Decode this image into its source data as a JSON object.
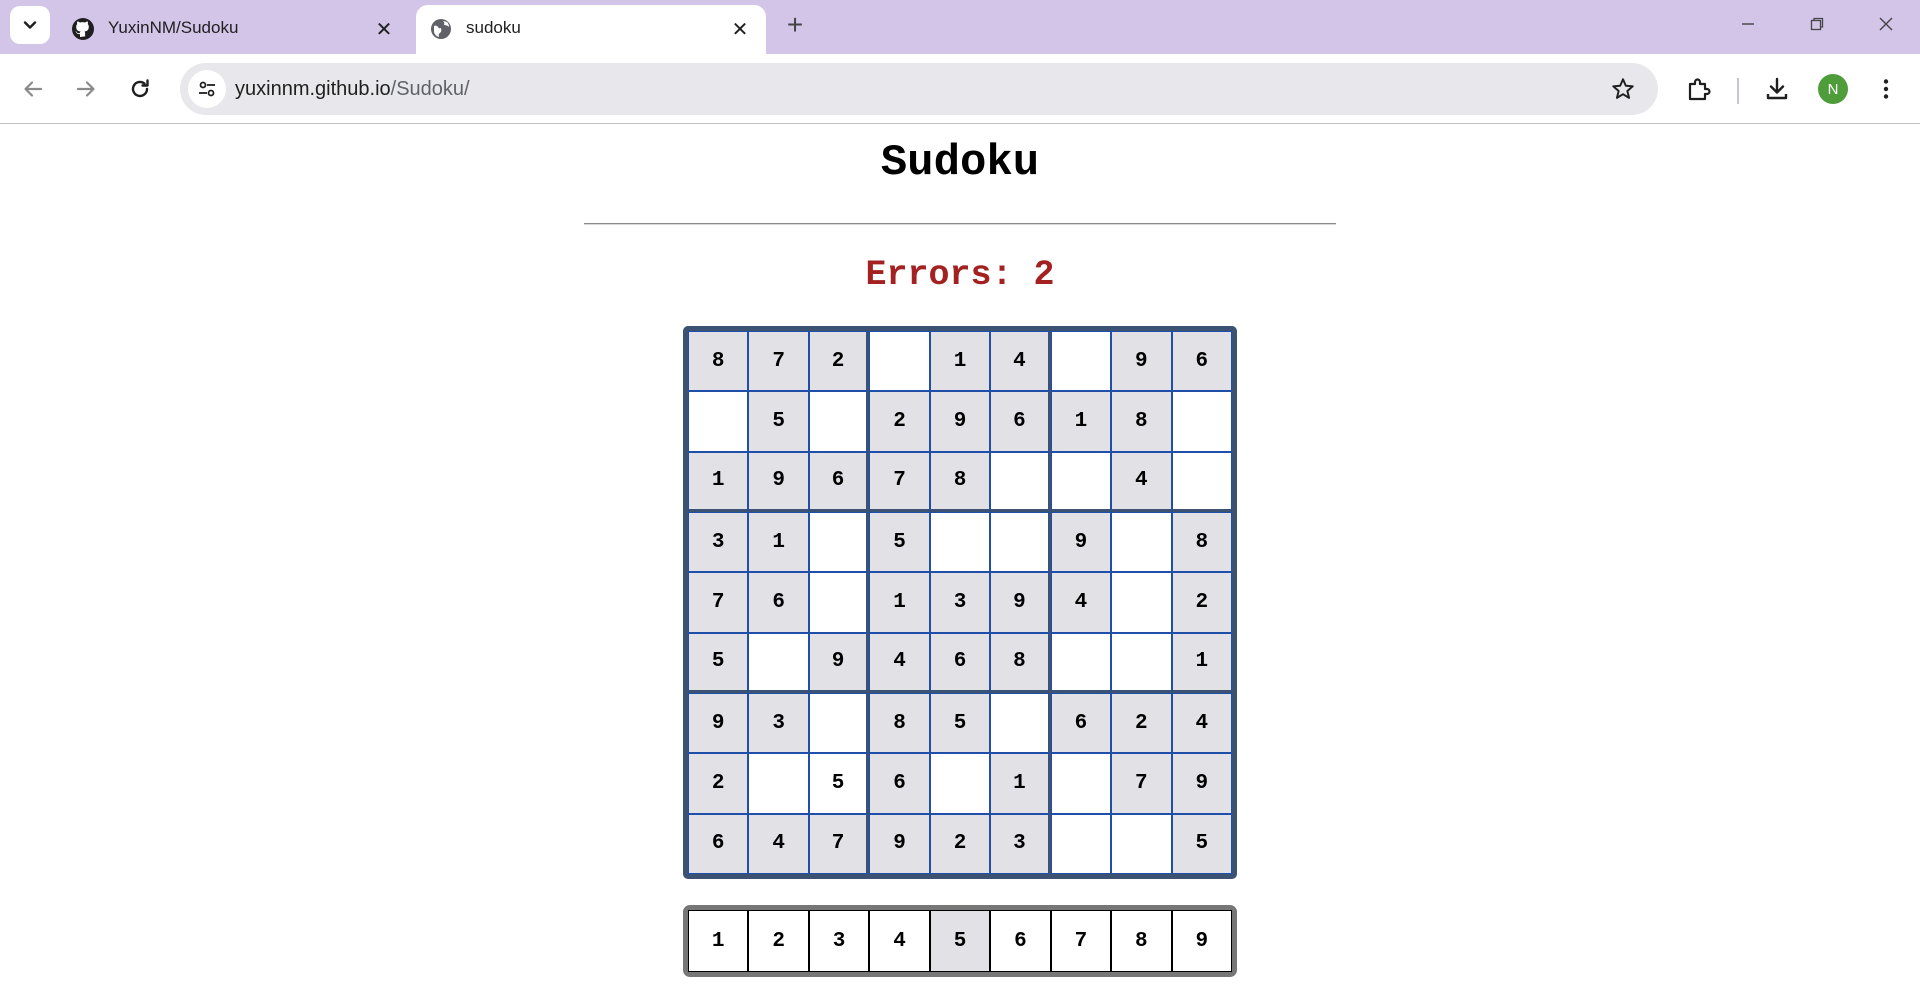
{
  "browser": {
    "tabs": [
      {
        "title": "YuxinNM/Sudoku",
        "icon": "github-icon",
        "active": false
      },
      {
        "title": "sudoku",
        "icon": "globe-icon",
        "active": true
      }
    ],
    "address": {
      "domain": "yuxinnm.github.io",
      "path": "/Sudoku/"
    },
    "profile_initial": "N"
  },
  "page": {
    "title": "Sudoku",
    "errors_text": "Errors: 2"
  },
  "board": [
    [
      "8",
      "7",
      "2",
      "",
      "1",
      "4",
      "",
      "9",
      "6"
    ],
    [
      "",
      "5",
      "",
      "2",
      "9",
      "6",
      "1",
      "8",
      ""
    ],
    [
      "1",
      "9",
      "6",
      "7",
      "8",
      "",
      "",
      "4",
      ""
    ],
    [
      "3",
      "1",
      "",
      "5",
      "",
      "",
      "9",
      "",
      "8"
    ],
    [
      "7",
      "6",
      "",
      "1",
      "3",
      "9",
      "4",
      "",
      "2"
    ],
    [
      "5",
      "",
      "9",
      "4",
      "6",
      "8",
      "",
      "",
      "1"
    ],
    [
      "9",
      "3",
      "",
      "8",
      "5",
      "",
      "6",
      "2",
      "4"
    ],
    [
      "2",
      "",
      "5",
      "6",
      "",
      "1",
      "",
      "7",
      "9"
    ],
    [
      "6",
      "4",
      "7",
      "9",
      "2",
      "3",
      "",
      "",
      "5"
    ]
  ],
  "shaded": [
    [
      1,
      1,
      1,
      0,
      1,
      1,
      0,
      1,
      1
    ],
    [
      0,
      1,
      0,
      1,
      1,
      1,
      1,
      1,
      0
    ],
    [
      1,
      1,
      1,
      1,
      1,
      0,
      0,
      1,
      0
    ],
    [
      1,
      1,
      0,
      1,
      0,
      0,
      1,
      0,
      1
    ],
    [
      1,
      1,
      0,
      1,
      1,
      1,
      1,
      0,
      1
    ],
    [
      1,
      0,
      1,
      1,
      1,
      1,
      0,
      0,
      1
    ],
    [
      1,
      1,
      0,
      1,
      1,
      0,
      1,
      1,
      1
    ],
    [
      1,
      0,
      0,
      1,
      0,
      1,
      0,
      1,
      1
    ],
    [
      1,
      1,
      1,
      1,
      1,
      1,
      0,
      0,
      1
    ]
  ],
  "digits": [
    "1",
    "2",
    "3",
    "4",
    "5",
    "6",
    "7",
    "8",
    "9"
  ],
  "selected_digit": "5"
}
